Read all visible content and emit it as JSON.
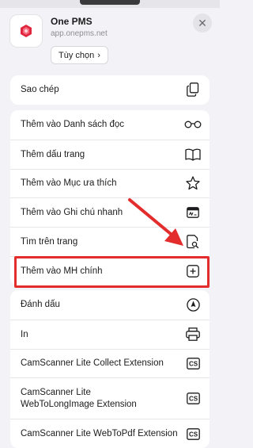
{
  "header": {
    "app_name": "One PMS",
    "app_url": "app.onepms.net",
    "options_label": "Tùy chọn",
    "options_chevron": "›",
    "close_glyph": "✕"
  },
  "menu": {
    "copy": {
      "label": "Sao chép",
      "icon": "copy-icon"
    },
    "group2": [
      {
        "label": "Thêm vào Danh sách đọc",
        "icon": "glasses-icon"
      },
      {
        "label": "Thêm dấu trang",
        "icon": "book-icon"
      },
      {
        "label": "Thêm vào Mục ưa thích",
        "icon": "star-icon"
      },
      {
        "label": "Thêm vào Ghi chú nhanh",
        "icon": "quick-note-icon"
      },
      {
        "label": "Tìm trên trang",
        "icon": "find-in-page-icon"
      },
      {
        "label": "Thêm vào MH chính",
        "icon": "add-square-icon"
      }
    ],
    "group3": [
      {
        "label": "Đánh dấu",
        "icon": "markup-icon"
      },
      {
        "label": "In",
        "icon": "printer-icon"
      },
      {
        "label": "CamScanner Lite Collect Extension",
        "icon": "cs-icon",
        "badge": "CS"
      },
      {
        "label": "CamScanner Lite\nWebToLongImage Extension",
        "icon": "cs-icon",
        "badge": "CS"
      },
      {
        "label": "CamScanner Lite WebToPdf Extension",
        "icon": "cs-icon",
        "badge": "CS"
      }
    ]
  },
  "colors": {
    "highlight": "#e32c2c",
    "brand": "#e0263f",
    "sheet_bg": "#f2f2f7"
  }
}
